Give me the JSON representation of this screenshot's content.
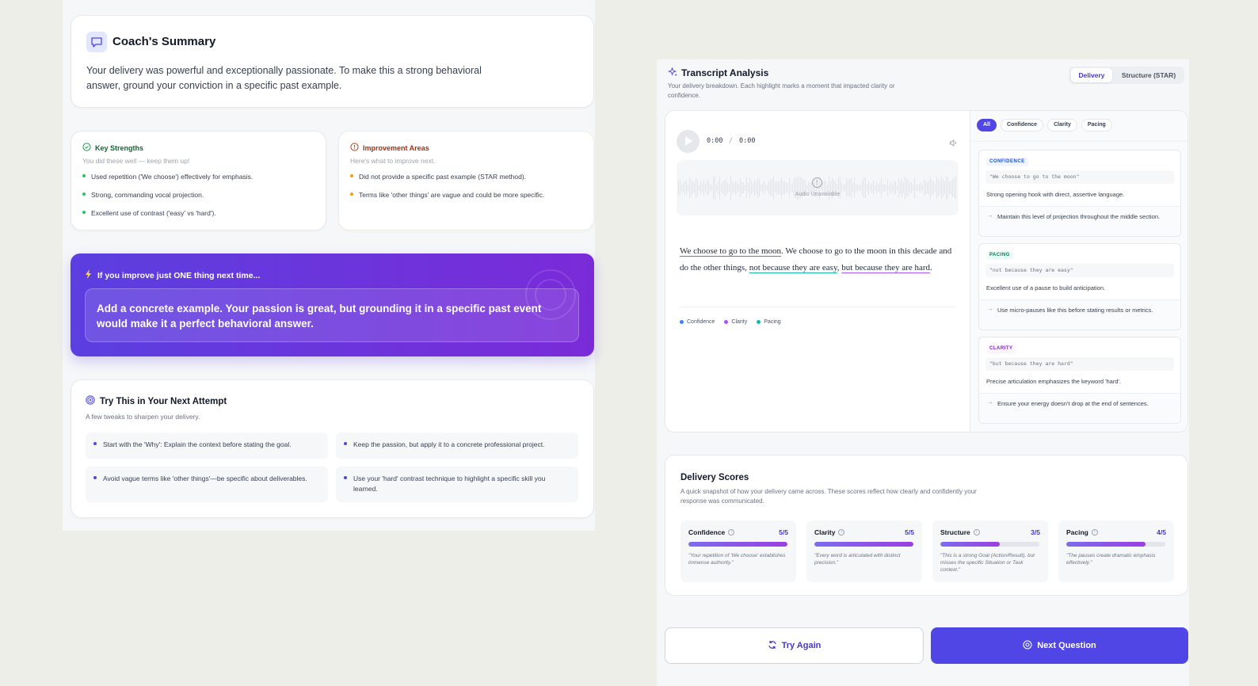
{
  "summary": {
    "title": "Coach's Summary",
    "body": "Your delivery was powerful and exceptionally passionate. To make this a strong behavioral answer, ground your conviction in a specific past example."
  },
  "strengths": {
    "title": "Key Strengths",
    "subtitle": "You did these well — keep them up!",
    "items": [
      "Used repetition ('We choose') effectively for emphasis.",
      "Strong, commanding vocal projection.",
      "Excellent use of contrast ('easy' vs 'hard')."
    ]
  },
  "improvements": {
    "title": "Improvement Areas",
    "subtitle": "Here's what to improve next.",
    "items": [
      "Did not provide a specific past example (STAR method).",
      "Terms like 'other things' are vague and could be more specific."
    ]
  },
  "one_thing": {
    "heading": "If you improve just ONE thing next time...",
    "text": "Add a concrete example. Your passion is great, but grounding it in a specific past event would make it a perfect behavioral answer."
  },
  "try_next": {
    "title": "Try This in Your Next Attempt",
    "subtitle": "A few tweaks to sharpen your delivery.",
    "tips": [
      "Start with the 'Why': Explain the context before stating the goal.",
      "Keep the passion, but apply it to a concrete professional project.",
      "Avoid vague terms like 'other things'—be specific about deliverables.",
      "Use your 'hard' contrast technique to highlight a specific skill you learned."
    ]
  },
  "transcript": {
    "title": "Transcript Analysis",
    "subtitle": "Your delivery breakdown. Each highlight marks a moment that impacted clarity or confidence.",
    "tabs": [
      "Delivery",
      "Structure (STAR)"
    ],
    "active_tab": "Delivery",
    "player": {
      "current_time": "0:00",
      "separator": "/",
      "duration": "0:00",
      "unavailable_label": "Audio Unavailable"
    },
    "segments": [
      {
        "text": "We choose to go to the moon",
        "highlight": "confidence"
      },
      {
        "text": ". We choose to go to the moon in this decade and do the other things, ",
        "highlight": null
      },
      {
        "text": "not because they are easy",
        "highlight": "pacing"
      },
      {
        "text": ", ",
        "highlight": null
      },
      {
        "text": "but because they are hard",
        "highlight": "clarity"
      },
      {
        "text": ".",
        "highlight": null
      }
    ],
    "legend": [
      {
        "label": "Confidence",
        "color": "#3b82f6"
      },
      {
        "label": "Clarity",
        "color": "#a855f7"
      },
      {
        "label": "Pacing",
        "color": "#14b8a6"
      }
    ],
    "filters": [
      "All",
      "Confidence",
      "Clarity",
      "Pacing"
    ],
    "active_filter": "All",
    "insights": [
      {
        "tag": "CONFIDENCE",
        "quote": "\"We choose to go to the moon\"",
        "observation": "Strong opening hook with direct, assertive language.",
        "tip": "Maintain this level of projection throughout the middle section."
      },
      {
        "tag": "PACING",
        "quote": "\"not because they are easy\"",
        "observation": "Excellent use of a pause to build anticipation.",
        "tip": "Use micro-pauses like this before stating results or metrics."
      },
      {
        "tag": "CLARITY",
        "quote": "\"but because they are hard\"",
        "observation": "Precise articulation emphasizes the keyword 'hard'.",
        "tip": "Ensure your energy doesn't drop at the end of sentences."
      }
    ]
  },
  "scores": {
    "title": "Delivery Scores",
    "subtitle": "A quick snapshot of how your delivery came across. These scores reflect how clearly and confidently your response was communicated.",
    "items": [
      {
        "name": "Confidence",
        "value": "5/5",
        "fraction": 1.0,
        "quote": "\"Your repetition of 'We choose' establishes immense authority.\""
      },
      {
        "name": "Clarity",
        "value": "5/5",
        "fraction": 1.0,
        "quote": "\"Every word is articulated with distinct precision.\""
      },
      {
        "name": "Structure",
        "value": "3/5",
        "fraction": 0.6,
        "quote": "\"This is a strong Goal (Action/Result), but misses the specific Situation or Task context.\""
      },
      {
        "name": "Pacing",
        "value": "4/5",
        "fraction": 0.8,
        "quote": "\"The pauses create dramatic emphasis effectively.\""
      }
    ]
  },
  "actions": {
    "try_again": "Try Again",
    "next_question": "Next Question"
  },
  "colors": {
    "accent": "#4f46e5",
    "gradient_start": "#5b3fe0",
    "gradient_end": "#7a2bd8",
    "strength": "#22c55e",
    "improvement": "#f59e0b"
  }
}
